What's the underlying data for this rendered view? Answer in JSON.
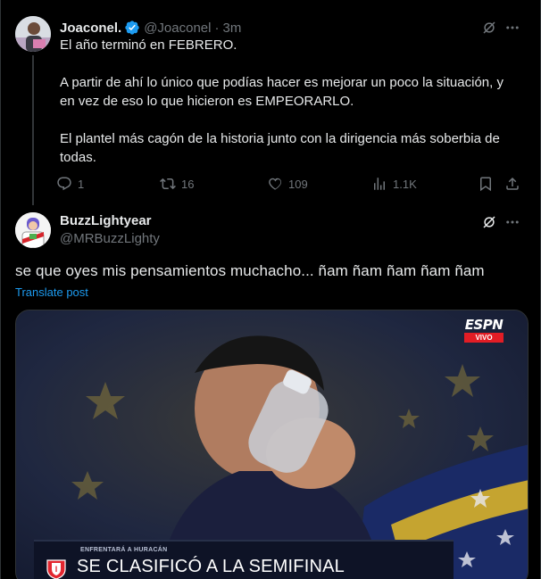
{
  "tweet1": {
    "name": "Joaconel.",
    "handle": "@Joaconel",
    "separator": "·",
    "time": "3m",
    "paragraphs": [
      "El año terminó en FEBRERO.",
      "A partir de ahí lo único que podías hacer es mejorar un poco la situación, y en vez de eso lo que hicieron es EMPEORARLO.",
      "El plantel más cagón de la historia junto con la dirigencia más soberbia de todas."
    ],
    "actions": {
      "replies": "1",
      "reposts": "16",
      "likes": "109",
      "views": "1.1K"
    }
  },
  "tweet2": {
    "name": "BuzzLightyear",
    "handle": "@MRBuzzLighty",
    "text": "se que oyes mis pensamientos muchacho... ñam ñam ñam ñam ñam",
    "translate_label": "Translate post",
    "media": {
      "channel_logo": "ESPN",
      "live_badge": "VIVO",
      "lower_third_subtitle": "ENFRENTARÁ A HURACÁN",
      "lower_third_title": "SE CLASIFICÓ A LA SEMIFINAL"
    }
  },
  "colors": {
    "background": "#000000",
    "text": "#e7e9ea",
    "muted": "#71767b",
    "accent": "#1d9bf0"
  },
  "icons": [
    "verified-badge-icon",
    "grok-icon",
    "more-icon",
    "reply-icon",
    "repost-icon",
    "like-icon",
    "views-icon",
    "bookmark-icon",
    "share-icon"
  ]
}
